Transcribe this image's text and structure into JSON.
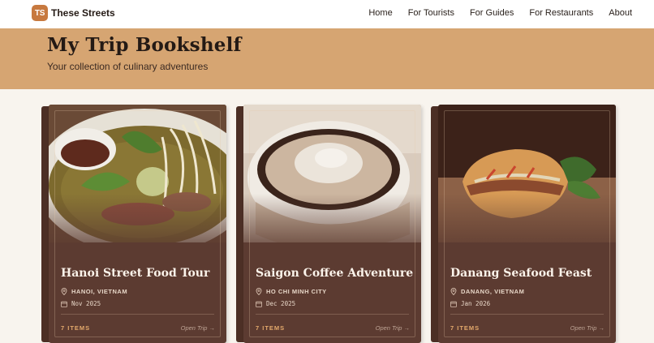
{
  "nav": {
    "logo_text": "TS",
    "brand": "These Streets",
    "links": [
      "Home",
      "For Tourists",
      "For Guides",
      "For Restaurants",
      "About"
    ]
  },
  "hero": {
    "title": "My Trip Bookshelf",
    "subtitle": "Your collection of culinary adventures"
  },
  "trips": [
    {
      "title": "Hanoi Street Food Tour",
      "location": "HANOI, VIETNAM",
      "date": "Nov 2025",
      "items": "7 ITEMS",
      "open_label": "Open Trip →",
      "image": "pho-bowl"
    },
    {
      "title": "Saigon Coffee Adventure",
      "location": "HO CHI MINH CITY",
      "date": "Dec 2025",
      "items": "7 ITEMS",
      "open_label": "Open Trip →",
      "image": "coffee-cup"
    },
    {
      "title": "Danang Seafood Feast",
      "location": "DANANG, VIETNAM",
      "date": "Jan 2026",
      "items": "7 ITEMS",
      "open_label": "Open Trip →",
      "image": "banh-mi"
    }
  ],
  "colors": {
    "accent": "#c7793f",
    "hero_bg": "#d6a572",
    "card_bg": "#5c3b31",
    "items_accent": "#e3a96c"
  }
}
